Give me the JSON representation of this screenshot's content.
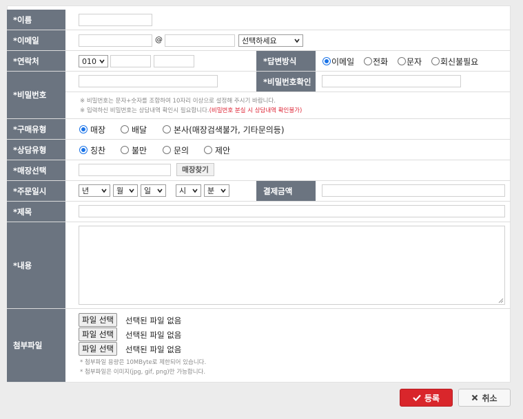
{
  "form": {
    "name": {
      "label": "*이름",
      "value": ""
    },
    "email": {
      "label": "*이메일",
      "local_value": "",
      "at": "@",
      "domain_value": "",
      "domain_select": "선택하세요"
    },
    "contact": {
      "label": "*연락처",
      "prefix_select": "010",
      "middle_value": "",
      "last_value": ""
    },
    "reply_method": {
      "label": "*답변방식",
      "options": [
        "이메일",
        "전화",
        "문자",
        "회신불필요"
      ],
      "selected": "이메일"
    },
    "password": {
      "label": "*비밀번호",
      "value": "",
      "confirm_label": "*비밀번호확인",
      "confirm_value": "",
      "hint1": "※ 비밀번호는 문자+숫자를 조합하여 10자리 이상으로 설정해 주시기 바랍니다.",
      "hint2_main": "※ 입력하신 비밀번호는 상담내역 확인시 필요합니다.",
      "hint2_red": "(비밀번호 분실 시 상담내역 확인불가)"
    },
    "purchase_type": {
      "label": "*구매유형",
      "options": [
        "매장",
        "배달",
        "본사(매장검색불가, 기타문의등)"
      ],
      "selected": "매장"
    },
    "consult_type": {
      "label": "*상담유형",
      "options": [
        "칭찬",
        "불만",
        "문의",
        "제안"
      ],
      "selected": "칭찬"
    },
    "store": {
      "label": "*매장선택",
      "value": "",
      "button": "매장찾기"
    },
    "order_date": {
      "label": "*주문일시",
      "year": "년",
      "month": "월",
      "day": "일",
      "hour": "시",
      "minute": "분",
      "payment_label": "결제금액",
      "payment_value": ""
    },
    "subject": {
      "label": "*제목",
      "value": ""
    },
    "content": {
      "label": "*내용",
      "value": ""
    },
    "attachment": {
      "label": "첨부파일",
      "button": "파일 선택",
      "status": "선택된 파일 없음",
      "hint1": "* 첨부파일 용량은 10MByte로 제한되어 있습니다.",
      "hint2": "* 첨부파일은 이미지(jpg, gif, png)만 가능합니다."
    }
  },
  "actions": {
    "submit": "등록",
    "cancel": "취소"
  },
  "colors": {
    "label_bg": "#6b7480",
    "submit_bg": "#d9262b",
    "radio_on": "#1a73e8"
  }
}
